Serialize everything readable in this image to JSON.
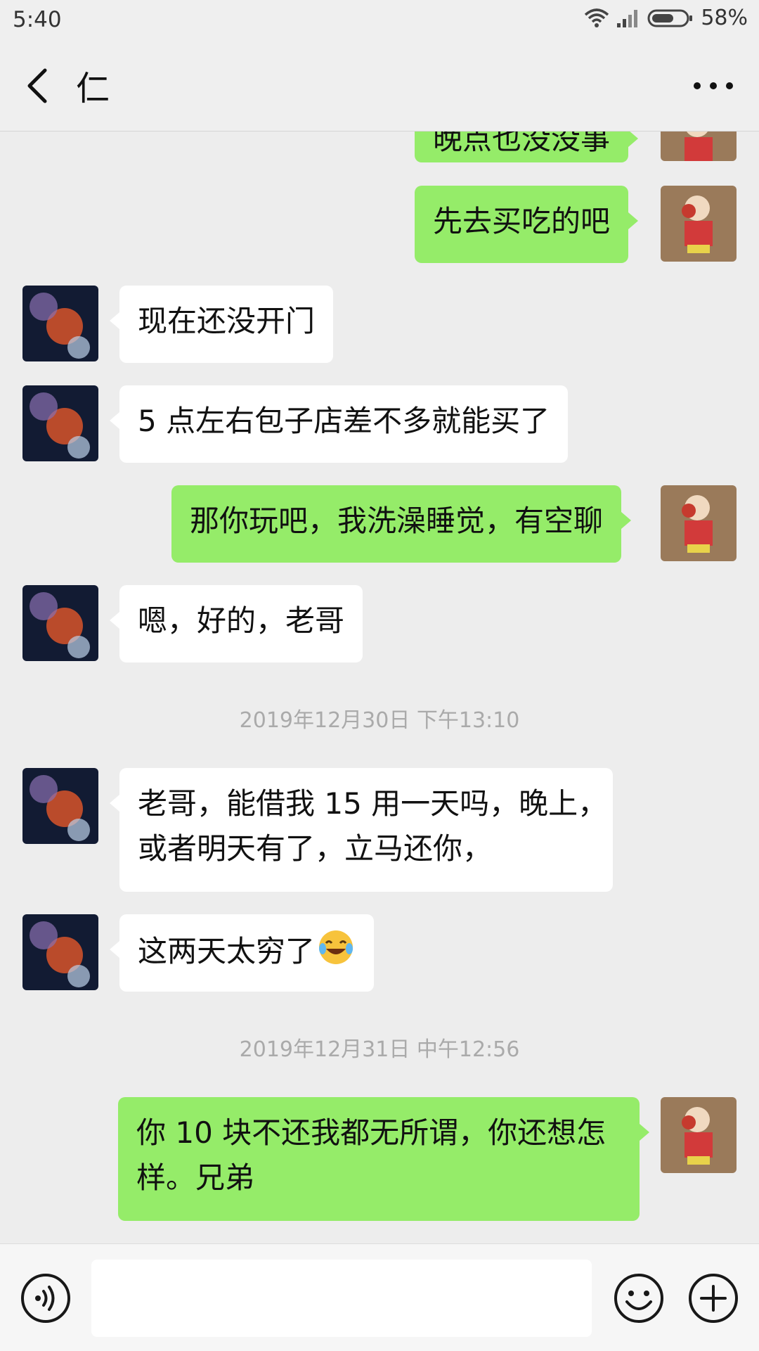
{
  "status_bar": {
    "time": "5:40",
    "battery": "58%"
  },
  "header": {
    "title": "仁"
  },
  "messages": {
    "m0": "晚点也没没事",
    "m1": "先去买吃的吧",
    "m2": "现在还没开门",
    "m3": "5 点左右包子店差不多就能买了",
    "m4": "那你玩吧，我洗澡睡觉，有空聊",
    "m5": "嗯，好的，老哥",
    "ts1": "2019年12月30日 下午13:10",
    "m6_line1": "老哥，能借我 15 用一天吗，晚上，",
    "m6_line2": "或者明天有了，立马还你，",
    "m7": "这两天太穷了",
    "ts2": "2019年12月31日 中午12:56",
    "m8_line1": "你 10 块不还我都无所谓，你还想怎",
    "m8_line2": "样。兄弟"
  },
  "icons": {
    "back": "chevron-left-icon",
    "more": "more-dots-icon",
    "voice": "voice-icon",
    "emoji": "emoji-icon",
    "plus": "plus-icon",
    "inline_emoji": "laughing-tears-emoji"
  },
  "colors": {
    "outgoing_bubble": "#95ec69",
    "incoming_bubble": "#ffffff",
    "background": "#ededed",
    "timestamp": "#aaaaaa"
  }
}
